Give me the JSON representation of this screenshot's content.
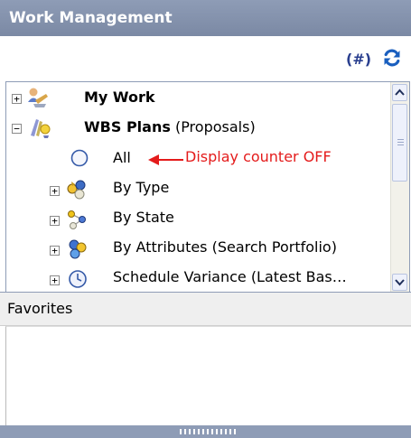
{
  "window": {
    "title": "Work Management"
  },
  "toolbar": {
    "counter_label": "(#)",
    "refresh_icon": "refresh-icon"
  },
  "tree": {
    "items": [
      {
        "label": "My Work",
        "bold": true,
        "icon": "my-work-icon",
        "expander": "+"
      },
      {
        "label_bold": "WBS Plans",
        "label_rest": " (Proposals)",
        "icon": "wbs-plans-icon",
        "expander": "−"
      },
      {
        "label": "All",
        "icon": "radio-icon"
      },
      {
        "label": "By Type",
        "icon": "by-type-icon",
        "expander": "+"
      },
      {
        "label": "By State",
        "icon": "by-state-icon",
        "expander": "+"
      },
      {
        "label": "By Attributes (Search Portfolio)",
        "icon": "by-attributes-icon",
        "expander": "+"
      },
      {
        "label": "Schedule Variance (Latest Bas…",
        "icon": "schedule-variance-icon",
        "expander": "+"
      }
    ]
  },
  "annotation": {
    "text": "Display counter OFF",
    "color": "#e41b1b"
  },
  "favorites": {
    "title": "Favorites"
  },
  "colors": {
    "titlebar": "#8e9cb6",
    "counter": "#2a3f8f",
    "refresh": "#1a5fbf"
  }
}
